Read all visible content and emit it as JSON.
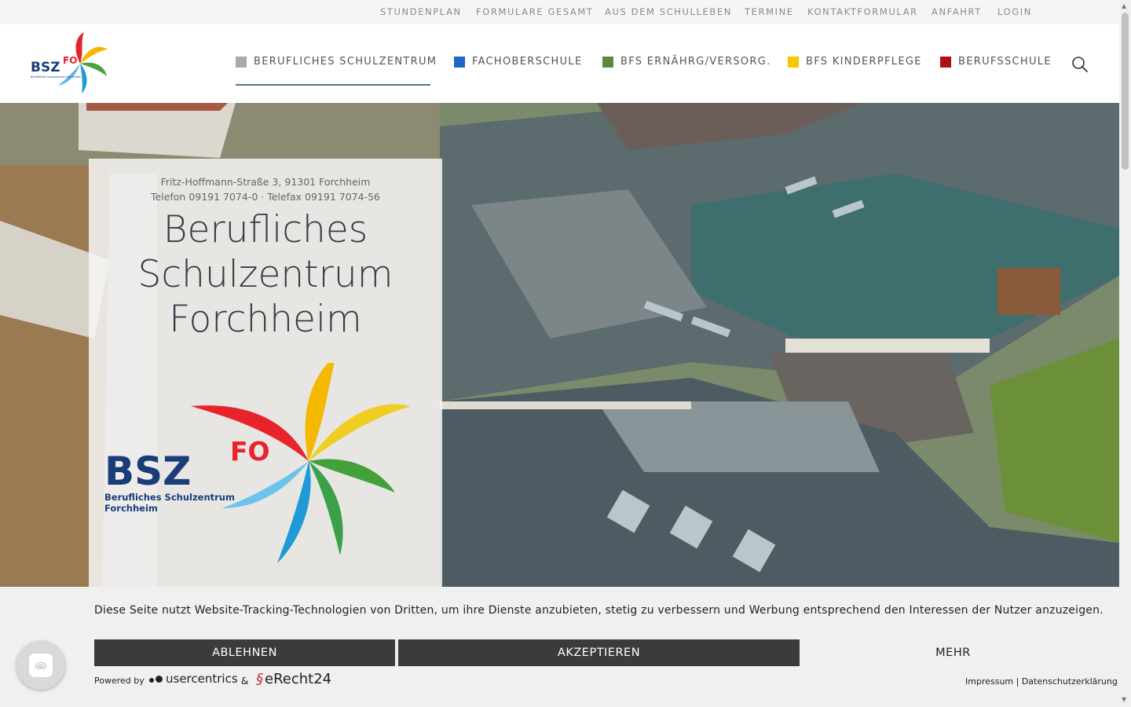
{
  "topnav": {
    "items": [
      "STUNDENPLAN",
      "FORMULARE GESAMT",
      "AUS DEM SCHULLEBEN",
      "TERMINE",
      "KONTAKTFORMULAR",
      "ANFAHRT",
      "LOGIN"
    ]
  },
  "logo": {
    "text": "BSZ",
    "superscript": "FO",
    "subtitle": "Berufliches Schulzentrum Forchheim"
  },
  "mainnav": {
    "items": [
      {
        "label": "BERUFLICHES SCHULZENTRUM",
        "color": "#aaaaaa",
        "active": true
      },
      {
        "label": "FACHOBERSCHULE",
        "color": "#1f66c6"
      },
      {
        "label": "BFS ERNÄHRG/VERSORG.",
        "color": "#5a8a3a"
      },
      {
        "label": "BFS KINDERPFLEGE",
        "color": "#f5c800"
      },
      {
        "label": "BERUFSSCHULE",
        "color": "#b01015"
      }
    ]
  },
  "hero": {
    "address": "Fritz-Hoffmann-Straße 3, 91301 Forchheim",
    "phone": "Telefon 09191 7074-0 · Telefax 09191 7074-56",
    "title_lines": [
      "Berufliches",
      "Schulzentrum",
      "Forchheim"
    ],
    "big_logo": {
      "text": "BSZ",
      "superscript": "FO",
      "line1": "Berufliches Schulzentrum",
      "line2": "Forchheim"
    }
  },
  "cookie": {
    "text": "Diese Seite nutzt Website-Tracking-Technologien von Dritten, um ihre Dienste anzubieten, stetig zu verbessern und Werbung entsprechend den Interessen der Nutzer anzuzeigen.",
    "decline": "ABLEHNEN",
    "accept": "AKZEPTIEREN",
    "more": "MEHR",
    "powered_by": "Powered by",
    "brand1": "usercentrics",
    "amp": "&",
    "brand2": "eRecht24",
    "legal": "Impressum | Datenschutzerklärung"
  }
}
